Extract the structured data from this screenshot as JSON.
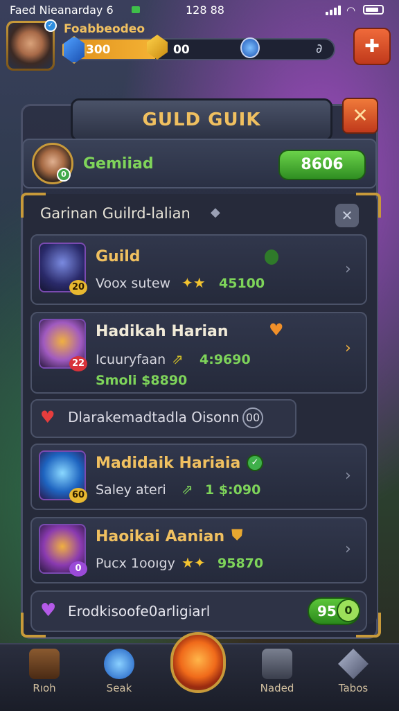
{
  "status_bar": {
    "carrier": "Faed Nieanarday",
    "carrier_num": "6",
    "time": "128 88"
  },
  "header": {
    "player_name": "Foabbeodeo",
    "resource_1": "300",
    "resource_2": "00",
    "link_glyph": "∂"
  },
  "panel": {
    "title": "GULD GUIK",
    "close_glyph": "✕",
    "member": {
      "name": "Gemiiad",
      "level": "0",
      "value": "8606"
    },
    "section_title": "Garinan Guilrd-lalian"
  },
  "cards": [
    {
      "title": "Guild",
      "subtitle": "Voox sutew",
      "stat": "45100",
      "level": "20",
      "title_color": "#f0c060"
    },
    {
      "title": "Hadikah Harian",
      "subtitle": "Icuuryfaan",
      "stat": "4:9690",
      "extra": "Smoli $8890",
      "level": "22",
      "title_color": "#f0ead8"
    },
    {
      "title": "Madidaik Hariaia",
      "subtitle": "Saley ateri",
      "stat": "1 $:090",
      "level": "60",
      "title_color": "#f0c060"
    },
    {
      "title": "Haoikai Aanian",
      "subtitle": "Pucx 1ooıgy",
      "stat": "95870",
      "level": "0",
      "title_color": "#f0c060"
    }
  ],
  "notice": {
    "text": "Dlarakemadtadla Oisonn",
    "count": "00"
  },
  "footer": {
    "text": "Erodkisoofe0arligiarl",
    "value": "95",
    "badge": "0"
  },
  "nav": [
    {
      "label": "Rıoh",
      "icon": "crate-icon"
    },
    {
      "label": "Seak",
      "icon": "orb-icon"
    },
    {
      "label": "Naded",
      "icon": "anvil-icon"
    },
    {
      "label": "Tabos",
      "icon": "sword-icon"
    }
  ],
  "colors": {
    "accent_gold": "#f0c060",
    "accent_green": "#7ed45a",
    "close_red": "#c0391b"
  }
}
